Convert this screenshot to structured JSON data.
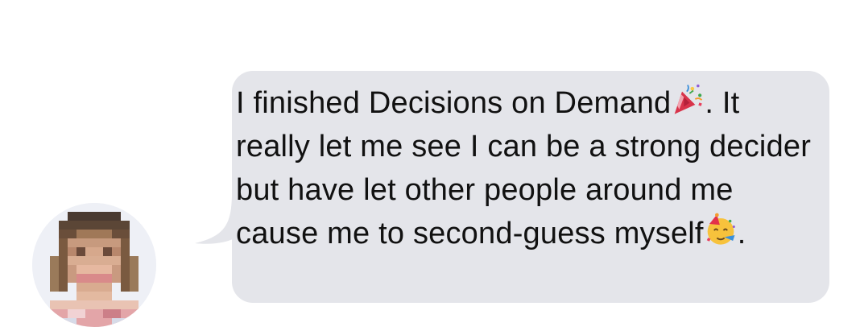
{
  "conversation": {
    "message": {
      "text_part_1": "I finished Decisions on Demand",
      "emoji_1": "party-popper",
      "text_part_2": ".  It really let me see I can be a strong decider but have let other people around me cause me to second-guess myself",
      "emoji_2": "partying-face",
      "text_part_3": "."
    },
    "avatar": {
      "description": "pixelated-profile-photo"
    }
  },
  "colors": {
    "bubble": "#e4e5ea",
    "text": "#111111",
    "background": "#ffffff"
  }
}
